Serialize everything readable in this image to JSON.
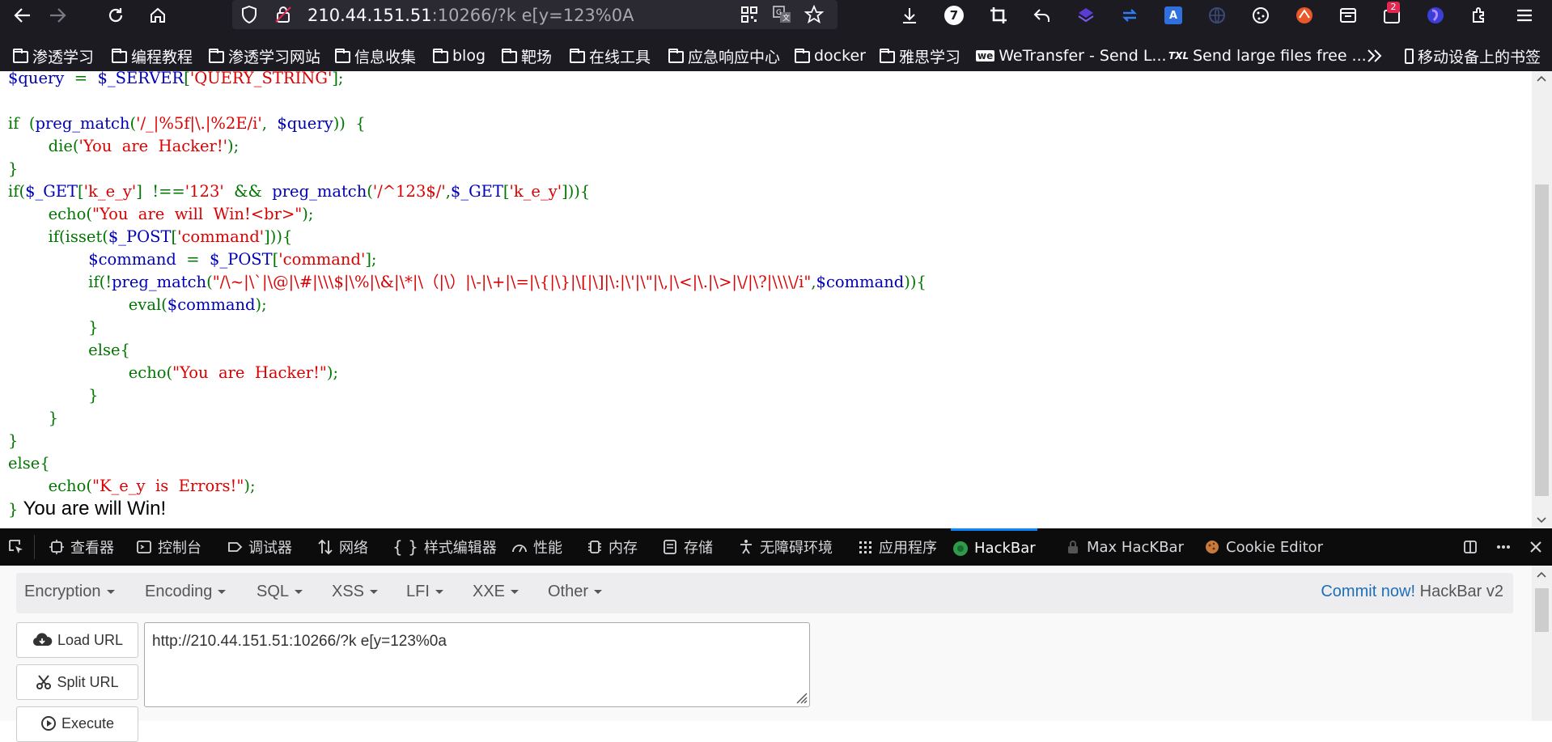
{
  "browser": {
    "url_host": "210.44.151.51",
    "url_rest": ":10266/?k e[y=123%0A",
    "notification_count": "7",
    "badge_count": "2"
  },
  "bookmarks": [
    {
      "label": "渗透学习",
      "type": "folder"
    },
    {
      "label": "编程教程",
      "type": "folder"
    },
    {
      "label": "渗透学习网站",
      "type": "folder"
    },
    {
      "label": "信息收集",
      "type": "folder"
    },
    {
      "label": "blog",
      "type": "folder"
    },
    {
      "label": "靶场",
      "type": "folder"
    },
    {
      "label": "在线工具",
      "type": "folder"
    },
    {
      "label": "应急响应中心",
      "type": "folder"
    },
    {
      "label": "docker",
      "type": "folder"
    },
    {
      "label": "雅思学习",
      "type": "folder"
    },
    {
      "label": "WeTransfer - Send L...",
      "type": "link"
    },
    {
      "label": "Send large files free ...",
      "type": "link"
    },
    {
      "label": "移动设备上的书签",
      "type": "mobile"
    }
  ],
  "page": {
    "win_text": "You are will Win!"
  },
  "devtools": {
    "tabs": [
      "查看器",
      "控制台",
      "调试器",
      "网络",
      "样式编辑器",
      "性能",
      "内存",
      "存储",
      "无障碍环境",
      "应用程序",
      "HackBar",
      "Max HacKBar",
      "Cookie Editor"
    ],
    "active_tab": "HackBar"
  },
  "hackbar": {
    "menus": [
      "Encryption",
      "Encoding",
      "SQL",
      "XSS",
      "LFI",
      "XXE",
      "Other"
    ],
    "commit_link": "Commit now!",
    "version": "HackBar v2",
    "load_url": "Load URL",
    "split_url": "Split URL",
    "execute": "Execute",
    "url_value": "http://210.44.151.51:10266/?k e[y=123%0a"
  }
}
